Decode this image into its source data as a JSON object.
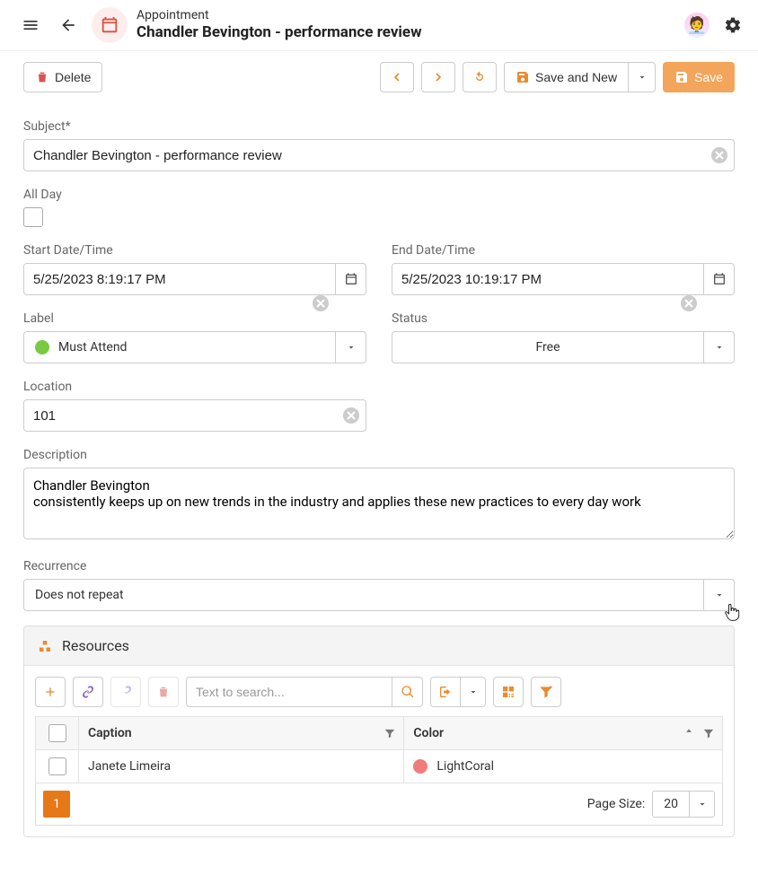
{
  "header": {
    "kind": "Appointment",
    "title": "Chandler Bevington - performance review"
  },
  "toolbar": {
    "delete_label": "Delete",
    "save_new_label": "Save and New",
    "save_label": "Save"
  },
  "labels": {
    "subject": "Subject*",
    "all_day": "All Day",
    "start": "Start Date/Time",
    "end": "End Date/Time",
    "label_field": "Label",
    "status": "Status",
    "location": "Location",
    "description": "Description",
    "recurrence": "Recurrence",
    "resources": "Resources",
    "page_size": "Page Size:"
  },
  "form": {
    "subject": "Chandler Bevington - performance review",
    "all_day": false,
    "start": "5/25/2023 8:19:17 PM",
    "end": "5/25/2023 10:19:17 PM",
    "label_value": "Must Attend",
    "label_color": "#7ac943",
    "status_value": "Free",
    "location": "101",
    "description": "Chandler Bevington\nconsistently keeps up on new trends in the industry and applies these new practices to every day work",
    "recurrence": "Does not repeat"
  },
  "resources": {
    "search_placeholder": "Text to search...",
    "columns": {
      "caption": "Caption",
      "color": "Color"
    },
    "rows": [
      {
        "caption": "Janete Limeira",
        "color_name": "LightCoral",
        "color_hex": "#ef7b7b"
      }
    ],
    "page": "1",
    "page_size": "20"
  }
}
